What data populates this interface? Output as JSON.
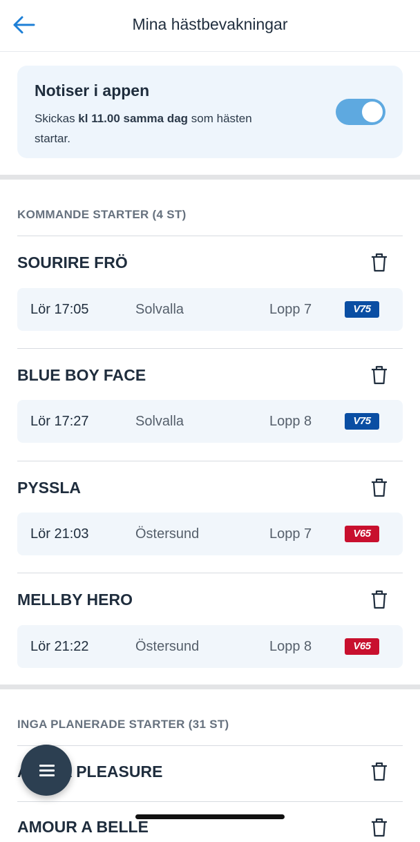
{
  "header": {
    "title": "Mina hästbevakningar"
  },
  "notifications": {
    "title": "Notiser i appen",
    "text_prefix": "Skickas ",
    "text_bold": "kl 11.00 samma dag",
    "text_suffix": " som hästen startar.",
    "toggle_on": true
  },
  "upcoming": {
    "header": "KOMMANDE STARTER (4 ST)",
    "horses": [
      {
        "name": "SOURIRE FRÖ",
        "time": "Lör 17:05",
        "track": "Solvalla",
        "race": "Lopp 7",
        "game": "V75",
        "game_color": "#0a4ea3"
      },
      {
        "name": "BLUE BOY FACE",
        "time": "Lör 17:27",
        "track": "Solvalla",
        "race": "Lopp 8",
        "game": "V75",
        "game_color": "#0a4ea3"
      },
      {
        "name": "PYSSLA",
        "time": "Lör 21:03",
        "track": "Östersund",
        "race": "Lopp 7",
        "game": "V65",
        "game_color": "#c8102e"
      },
      {
        "name": "MELLBY HERO",
        "time": "Lör 21:22",
        "track": "Östersund",
        "race": "Lopp 8",
        "game": "V65",
        "game_color": "#c8102e"
      }
    ]
  },
  "unplanned": {
    "header": "INGA PLANERADE STARTER (31 ST)",
    "horses": [
      {
        "name": "A... S A PLEASURE"
      },
      {
        "name": "AMOUR A BELLE"
      }
    ]
  },
  "fab": {
    "icon": "menu-icon"
  }
}
